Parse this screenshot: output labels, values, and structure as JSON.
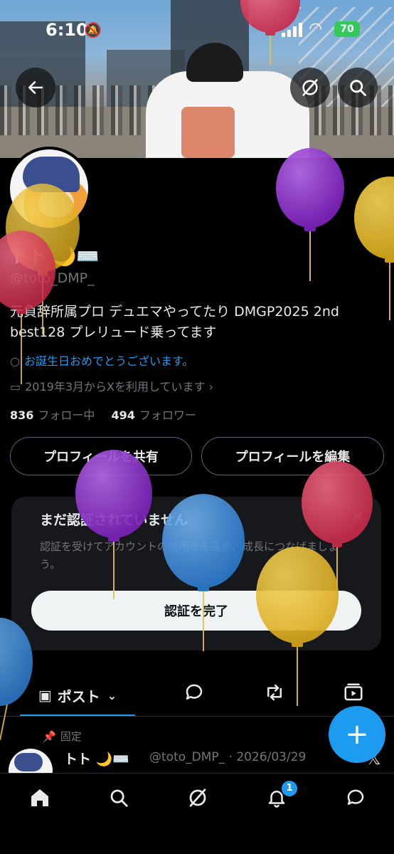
{
  "status_bar": {
    "time": "6:10",
    "battery": "70"
  },
  "profile": {
    "name": "トト 🌙⌨️",
    "handle": "@toto_DMP_",
    "bio": "元負辞所属プロ デュエマやってたり DMGP2025 2nd best128 プレリュード乗ってます",
    "birthday_message": "お誕生日おめでとうございます。",
    "joined": "2019年3月からXを利用しています",
    "following_count": "836",
    "following_label": "フォロー中",
    "followers_count": "494",
    "followers_label": "フォロワー"
  },
  "actions": {
    "share_label": "プロフィールを共有",
    "edit_label": "プロフィールを編集"
  },
  "verify_card": {
    "title": "まだ認証されていません",
    "description": "認証を受けてアカウントの信用度を高め、成長につなげましょう。",
    "button_label": "認証を完了"
  },
  "tabs": {
    "posts_label": "ポスト"
  },
  "pinned_post": {
    "pinned_label": "固定",
    "author_name": "トト 🌙⌨️",
    "meta": "@toto_DMP_ · 2026/03/29"
  },
  "notifications": {
    "badge_count": "1"
  },
  "icons": {
    "back": "back-arrow-icon",
    "grok": "grok-icon",
    "search": "search-icon",
    "home": "home-icon",
    "notifications": "bell-icon",
    "messages": "messages-icon"
  },
  "colors": {
    "accent": "#1d9bf0",
    "background": "#000000",
    "muted": "#71767b",
    "balloon_purple": "#8b34c9",
    "balloon_yellow": "#e2b62e",
    "balloon_red": "#d63b58",
    "balloon_blue": "#3d8ee0"
  }
}
